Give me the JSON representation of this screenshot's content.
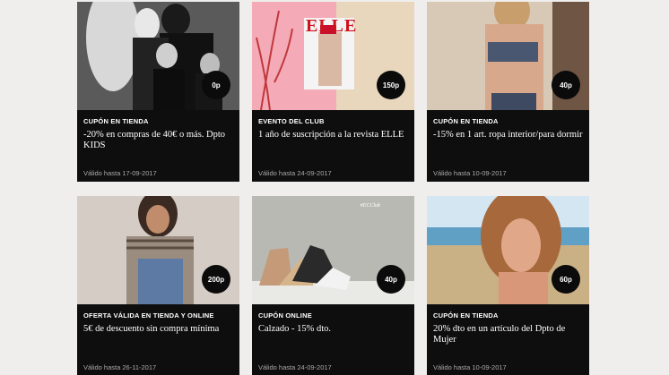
{
  "cards": [
    {
      "type": "CUPÓN EN TIENDA",
      "title": "-20% en compras de 40€ o más. Dpto KIDS",
      "valid": "Válido hasta 17-09-2017",
      "points": "0p",
      "image": "family-kids-photo"
    },
    {
      "type": "EVENTO DEL CLUB",
      "title": "1 año de suscripción a la revista ELLE",
      "valid": "Válido hasta 24-09-2017",
      "points": "150p",
      "image": "elle-magazine-cover",
      "magazine_mark": "ELLE"
    },
    {
      "type": "CUPÓN EN TIENDA",
      "title": "-15% en 1 art. ropa interior/para dormir",
      "valid": "Válido hasta 10-09-2017",
      "points": "40p",
      "image": "lingerie-model-photo"
    },
    {
      "type": "OFERTA VÁLIDA EN TIENDA Y ONLINE",
      "title": "5€ de descuento sin compra mínima",
      "valid": "Válido hasta 26-11-2017",
      "points": "200p",
      "image": "denim-overalls-model-photo"
    },
    {
      "type": "CUPÓN ONLINE",
      "title": "Calzado - 15% dto.",
      "valid": "Válido hasta 24-09-2017",
      "points": "40p",
      "image": "shoes-photo",
      "club_mark": "#ECClub"
    },
    {
      "type": "CUPÓN EN TIENDA",
      "title": "20% dto en un artículo del Dpto de Mujer",
      "valid": "Válido hasta 10-09-2017",
      "points": "60p",
      "image": "beach-model-photo"
    }
  ]
}
